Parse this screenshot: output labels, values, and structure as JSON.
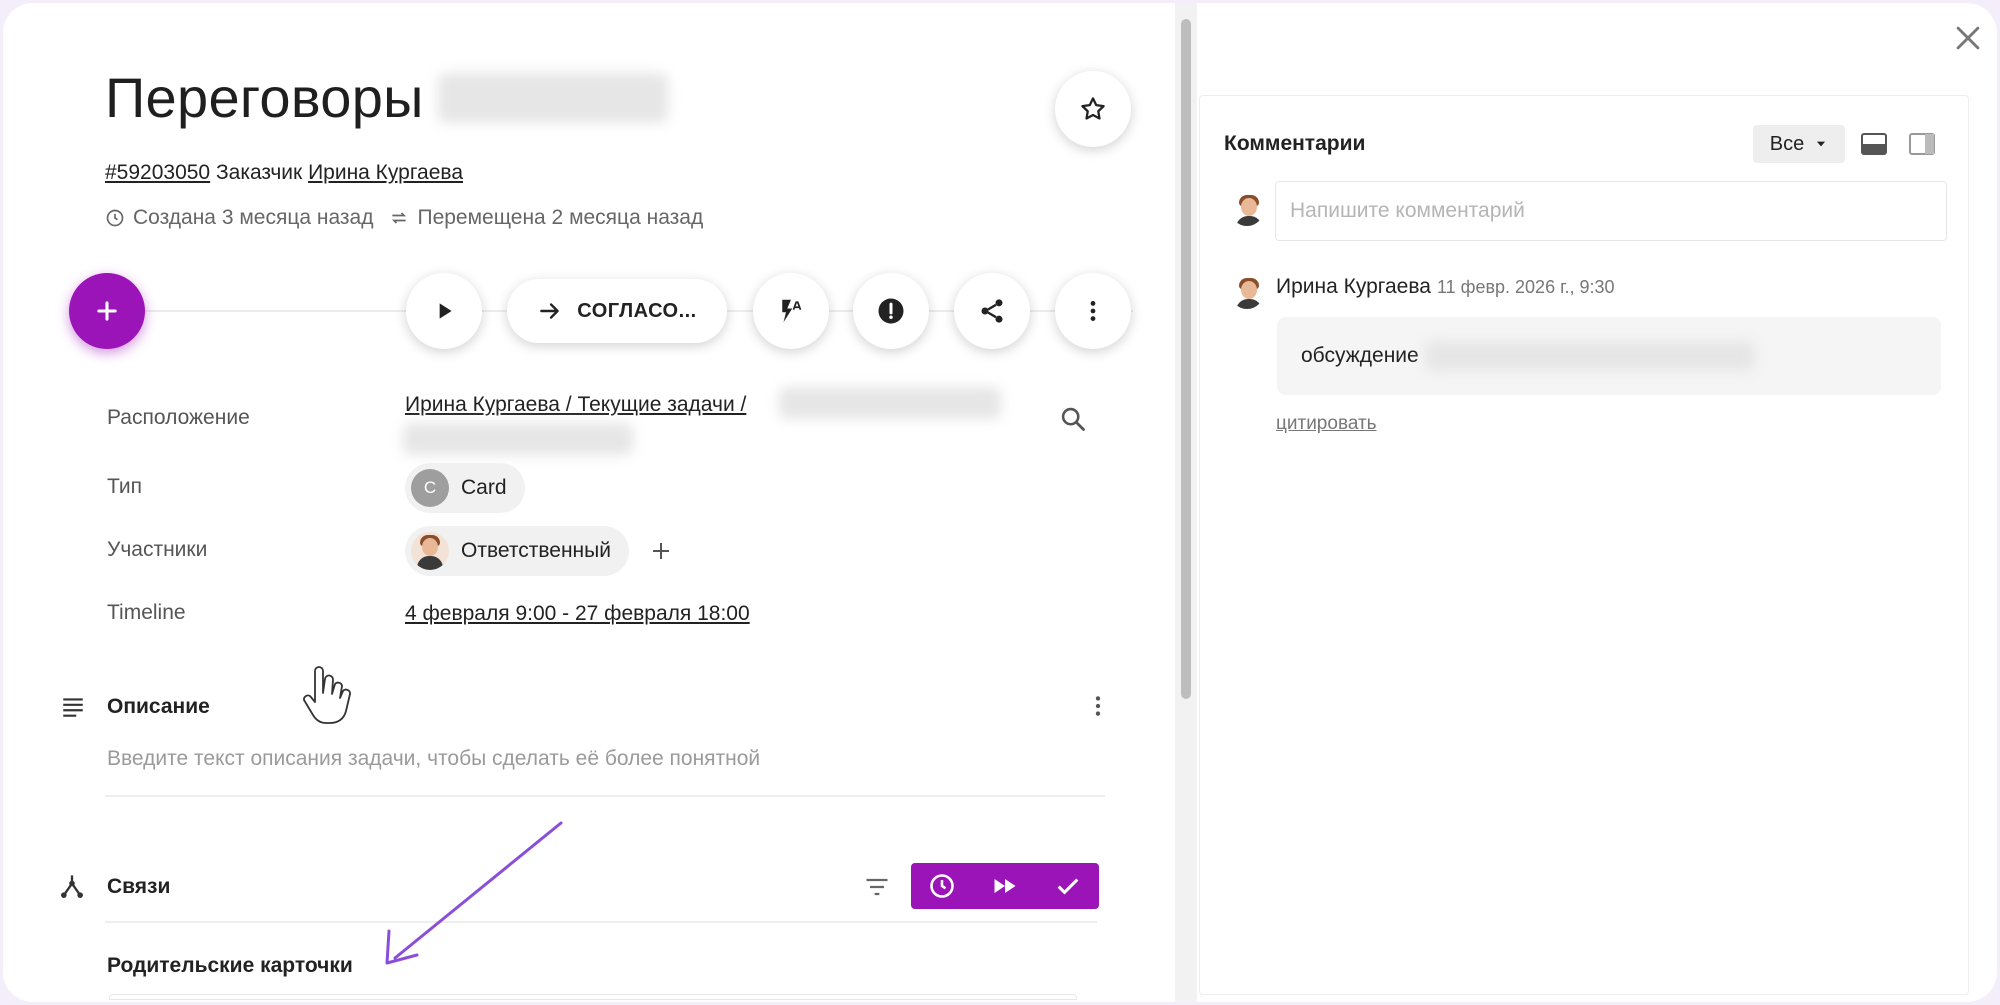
{
  "card": {
    "title": "Переговоры",
    "id_link": "#59203050",
    "customer_label": "Заказчик",
    "customer_name": "Ирина Кургаева",
    "created": "Создана 3 месяца назад",
    "moved": "Перемещена 2 месяца назад"
  },
  "toolbar": {
    "add_icon": "plus-icon",
    "play_icon": "play-icon",
    "stage_label": "СОГЛАСО...",
    "stage_icon": "arrow-right-icon",
    "automation_icon": "flash-auto-icon",
    "alert_icon": "alert-circle-icon",
    "share_icon": "share-icon",
    "more_icon": "more-vert-icon"
  },
  "properties": {
    "location_label": "Расположение",
    "location_value": "Ирина Кургаева / Текущие задачи /",
    "type_label": "Тип",
    "type_avatar_letter": "C",
    "type_value": "Card",
    "participants_label": "Участники",
    "participant_role": "Ответственный",
    "timeline_label": "Timeline",
    "timeline_value": "4 февраля 9:00 - 27 февраля 18:00"
  },
  "description": {
    "title": "Описание",
    "placeholder": "Введите текст описания задачи, чтобы сделать её более понятной"
  },
  "links": {
    "title": "Связи",
    "parent_cards_title": "Родительские карточки"
  },
  "comments": {
    "title": "Комментарии",
    "filter_value": "Все",
    "input_placeholder": "Напишите комментарий",
    "items": [
      {
        "author": "Ирина Кургаева",
        "date": "11 февр. 2026 г., 9:30",
        "text": "обсуждение",
        "quote_label": "цитировать"
      }
    ]
  },
  "colors": {
    "accent": "#9b14b8",
    "annotation_arrow": "#8a4fd8"
  }
}
